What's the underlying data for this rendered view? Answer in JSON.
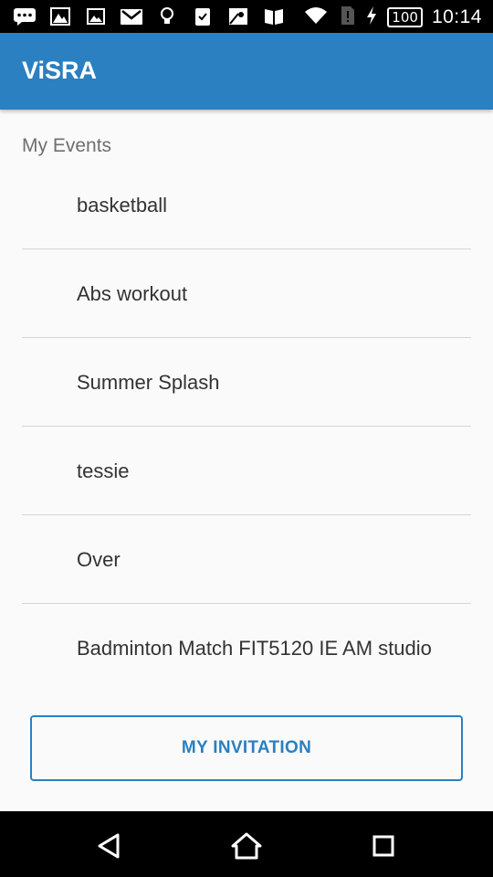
{
  "status_bar": {
    "battery": "100",
    "time": "10:14",
    "icons": [
      "message-icon",
      "image-icon",
      "photo-icon",
      "gmail-icon",
      "bulb-icon",
      "clipboard-check-icon",
      "maps-icon",
      "book-icon",
      "wifi-icon",
      "sim-alert-icon",
      "charging-icon"
    ]
  },
  "app_bar": {
    "title": "ViSRA"
  },
  "section": {
    "title": "My Events"
  },
  "events": [
    {
      "label": "basketball"
    },
    {
      "label": "Abs workout"
    },
    {
      "label": "Summer Splash"
    },
    {
      "label": "tessie"
    },
    {
      "label": "Over"
    },
    {
      "label": "Badminton Match FIT5120 IE AM studio"
    }
  ],
  "invite_button": {
    "label": "MY INVITATION"
  },
  "nav_bar": {
    "icons": [
      "back-icon",
      "home-icon",
      "recents-icon"
    ]
  },
  "colors": {
    "primary": "#2a80c0",
    "background": "#fafafa",
    "text": "#333333",
    "subtle_text": "#6f6f6f",
    "divider": "#d6d6d6"
  }
}
